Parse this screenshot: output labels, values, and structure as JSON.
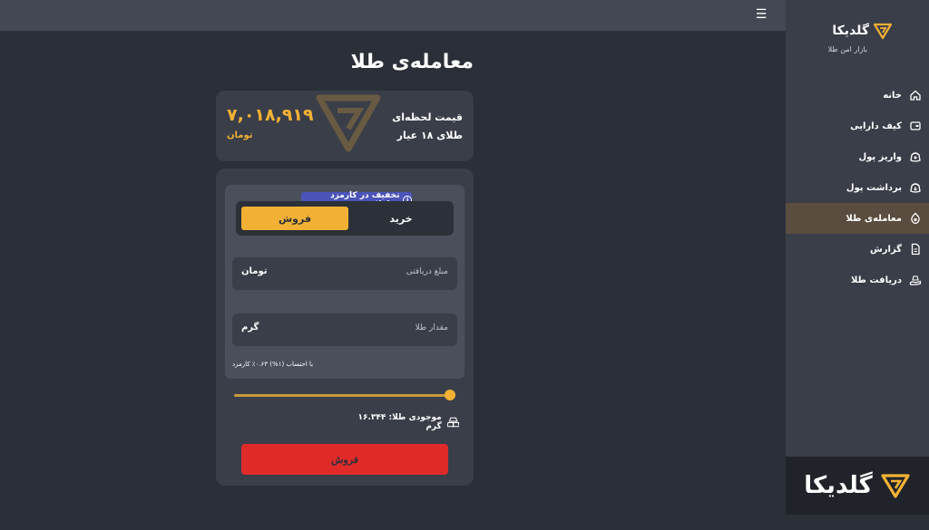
{
  "brand": {
    "name": "گلدیکا",
    "tagline": "بازار امن طلا",
    "accent": "#f2b134"
  },
  "nav": {
    "items": [
      {
        "label": "خانه",
        "icon": "home-icon",
        "active": false
      },
      {
        "label": "کیف دارایی",
        "icon": "wallet-icon",
        "active": false
      },
      {
        "label": "واریز پول",
        "icon": "deposit-icon",
        "active": false
      },
      {
        "label": "برداشت پول",
        "icon": "withdraw-icon",
        "active": false
      },
      {
        "label": "معامله‌ی طلا",
        "icon": "gold-trade-icon",
        "active": true
      },
      {
        "label": "گزارش",
        "icon": "report-icon",
        "active": false
      },
      {
        "label": "دریافت طلا",
        "icon": "receive-gold-icon",
        "active": false
      }
    ]
  },
  "page": {
    "title": "معامله‌ی طلا"
  },
  "price": {
    "label_line1": "قیمت لحظه‌ای",
    "label_line2": "طلای ۱۸ عیار",
    "value": "۷,۰۱۸,۹۱۹",
    "unit": "تومان"
  },
  "trade": {
    "discount_badge": "تخفیف در کارمزد معاملات",
    "tabs": {
      "sell": "فروش",
      "buy": "خرید",
      "selected": "sell"
    },
    "amount_field": {
      "placeholder": "مبلغ دریافتی",
      "unit": "تومان"
    },
    "gold_field": {
      "placeholder": "مقدار طلا",
      "unit": "گرم"
    },
    "fee_note": "با احتساب (۱%) ۰.۶۳٪ کارمزد",
    "slider_fraction": 1.0,
    "balance": "موجودی طلا: ۱۶.۳۴۴ گرم",
    "submit_label": "فروش",
    "submit_color": "#e02a2a"
  }
}
